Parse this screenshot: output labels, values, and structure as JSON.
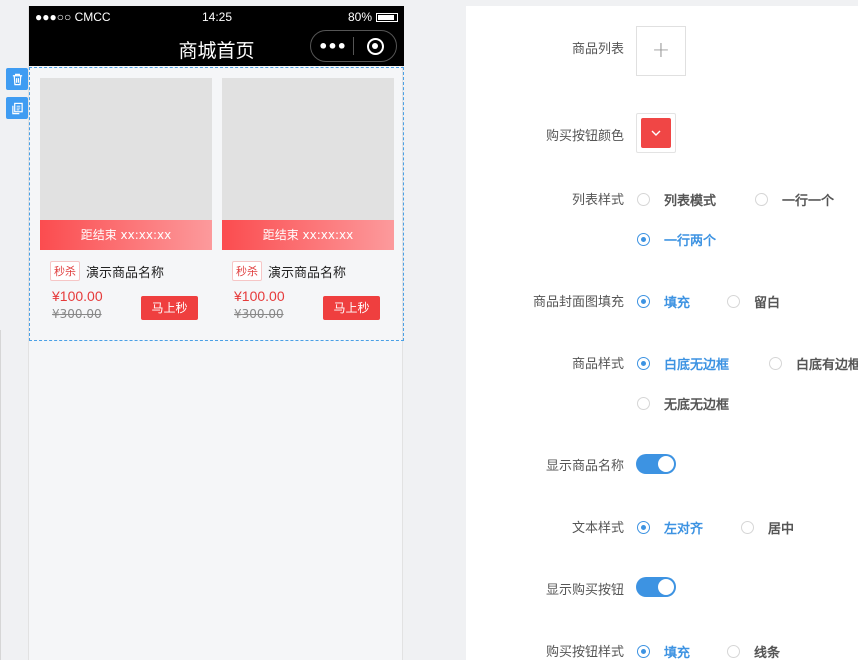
{
  "status_bar": {
    "carrier": "●●●○○ CMCC",
    "time": "14:25",
    "battery": "80%"
  },
  "nav": {
    "title": "商城首页",
    "more_glyph": "•••"
  },
  "products": [
    {
      "countdown": "距结束 xx:xx:xx",
      "tag": "秒杀",
      "name": "演示商品名称",
      "price": "¥100.00",
      "original_price": "¥300.00",
      "buy_label": "马上秒"
    },
    {
      "countdown": "距结束 xx:xx:xx",
      "tag": "秒杀",
      "name": "演示商品名称",
      "price": "¥100.00",
      "original_price": "¥300.00",
      "buy_label": "马上秒"
    }
  ],
  "settings": {
    "product_list": {
      "label": "商品列表",
      "add_glyph": "+"
    },
    "buy_button_color": {
      "label": "购买按钮颜色",
      "color": "#f04645"
    },
    "list_style": {
      "label": "列表样式",
      "options": [
        "列表模式",
        "一行一个",
        "一行两个"
      ],
      "selected": "一行两个"
    },
    "cover_fill": {
      "label": "商品封面图填充",
      "options": [
        "填充",
        "留白"
      ],
      "selected": "填充"
    },
    "product_style": {
      "label": "商品样式",
      "options": [
        "白底无边框",
        "白底有边框",
        "无底无边框"
      ],
      "selected": "白底无边框"
    },
    "show_name": {
      "label": "显示商品名称",
      "on": true
    },
    "text_style": {
      "label": "文本样式",
      "options": [
        "左对齐",
        "居中"
      ],
      "selected": "左对齐"
    },
    "show_buy": {
      "label": "显示购买按钮",
      "on": true
    },
    "buy_style": {
      "label": "购买按钮样式",
      "options": [
        "填充",
        "线条"
      ],
      "selected": "填充"
    }
  },
  "colors": {
    "accent": "#3d93e2",
    "sale_red": "#ef3f3f"
  }
}
